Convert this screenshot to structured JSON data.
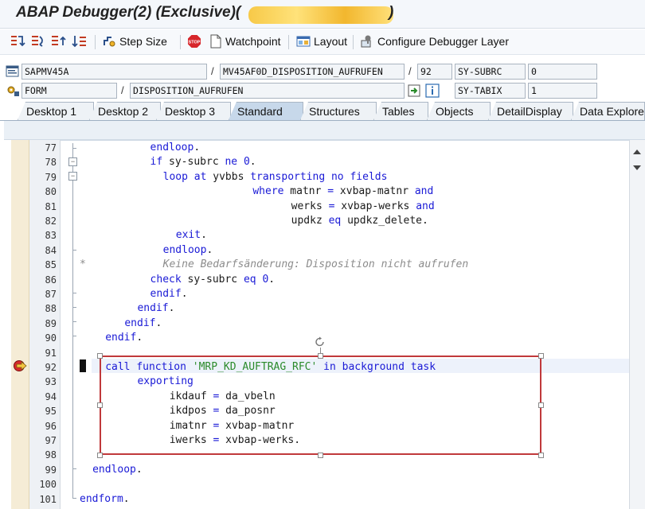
{
  "window": {
    "title": "ABAP Debugger(2)  (Exclusive)(",
    "title_end": ")"
  },
  "toolbar": {
    "step_size_label": "Step Size",
    "watchpoint_label": "Watchpoint",
    "layout_label": "Layout",
    "configure_layer_label": "Configure Debugger Layer"
  },
  "info": {
    "program": "SAPMV45A",
    "include": "MV45AF0D_DISPOSITION_AUFRUFEN",
    "line": "92",
    "event_type": "FORM",
    "event_name": "DISPOSITION_AUFRUFEN",
    "var1_name": "SY-SUBRC",
    "var1_value": "0",
    "var2_name": "SY-TABIX",
    "var2_value": "1"
  },
  "tabs": [
    {
      "label": "Desktop 1"
    },
    {
      "label": "Desktop 2"
    },
    {
      "label": "Desktop 3"
    },
    {
      "label": "Standard"
    },
    {
      "label": "Structures"
    },
    {
      "label": "Tables"
    },
    {
      "label": "Objects"
    },
    {
      "label": "DetailDisplay"
    },
    {
      "label": "Data Explore"
    }
  ],
  "active_tab": "Standard",
  "code_lines": [
    {
      "no": "77",
      "text": "endloop."
    },
    {
      "no": "78",
      "text": "if sy-subrc ne 0."
    },
    {
      "no": "79",
      "text": "loop at yvbbs transporting no fields"
    },
    {
      "no": "80",
      "text": "where matnr = xvbap-matnr and"
    },
    {
      "no": "81",
      "text": "werks = xvbap-werks and"
    },
    {
      "no": "82",
      "text": "updkz eq updkz_delete."
    },
    {
      "no": "83",
      "text": "exit."
    },
    {
      "no": "84",
      "text": "endloop."
    },
    {
      "no": "85",
      "text": "Keine Bedarfsänderung: Disposition nicht aufrufen"
    },
    {
      "no": "86",
      "text": "check sy-subrc eq 0."
    },
    {
      "no": "87",
      "text": "endif."
    },
    {
      "no": "88",
      "text": "endif."
    },
    {
      "no": "89",
      "text": "endif."
    },
    {
      "no": "90",
      "text": "endif."
    },
    {
      "no": "91",
      "text": ""
    },
    {
      "no": "92",
      "text": "call function 'MRP_KD_AUFTRAG_RFC' in background task"
    },
    {
      "no": "93",
      "text": "exporting"
    },
    {
      "no": "94",
      "text": "ikdauf = da_vbeln"
    },
    {
      "no": "95",
      "text": "ikdpos = da_posnr"
    },
    {
      "no": "96",
      "text": "imatnr = xvbap-matnr"
    },
    {
      "no": "97",
      "text": "iwerks = xvbap-werks."
    },
    {
      "no": "98",
      "text": ""
    },
    {
      "no": "99",
      "text": "endloop."
    },
    {
      "no": "100",
      "text": ""
    },
    {
      "no": "101",
      "text": "endform."
    }
  ],
  "comment_marker": "*",
  "colors": {
    "keyword": "#1a1ad6",
    "string": "#2a8a2a",
    "comment": "#8c8c8c",
    "active_tab": "#c7d8ea",
    "selection_border": "#c0393b"
  },
  "icons": [
    "step-into-icon",
    "step-over-icon",
    "step-return-icon",
    "continue-icon",
    "step-size-icon",
    "stop-icon",
    "watchpoint-icon",
    "layout-icon",
    "configure-layer-icon",
    "program-icon",
    "event-icon",
    "breakpoint-arrow-icon"
  ]
}
